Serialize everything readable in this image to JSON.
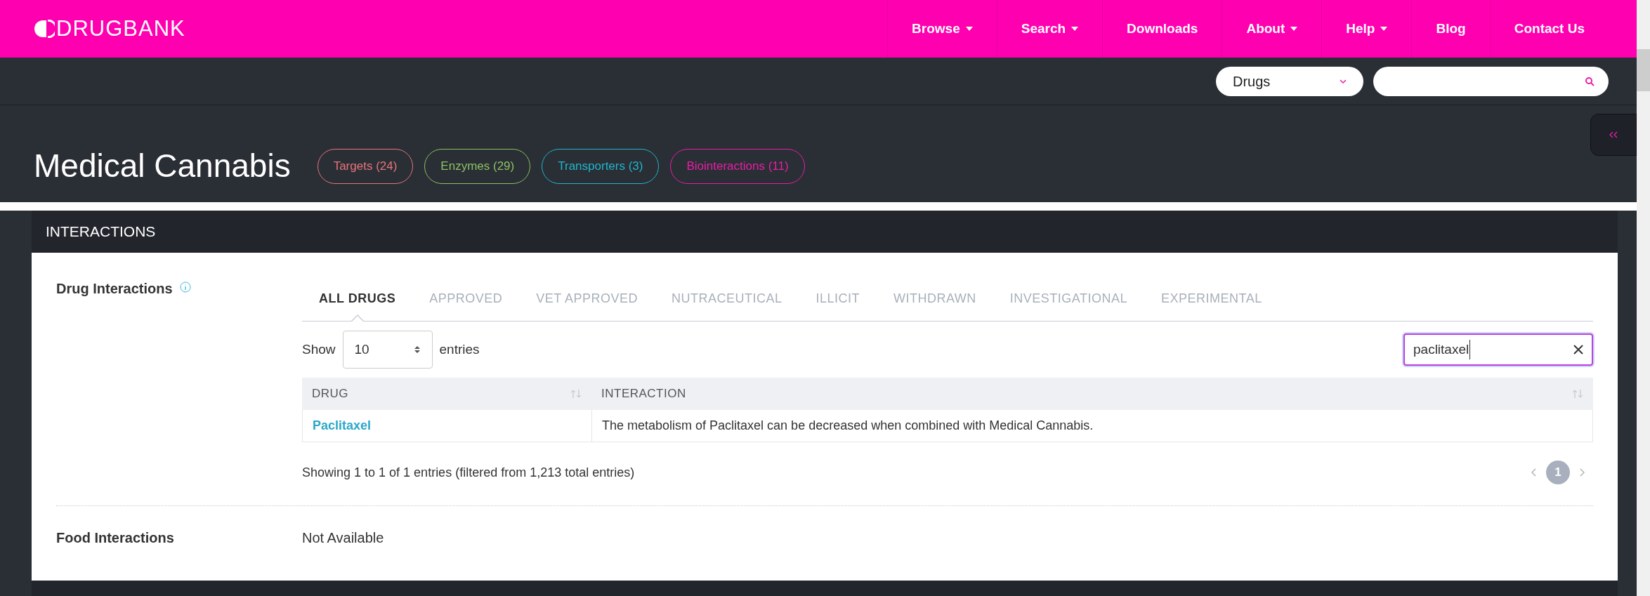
{
  "brand": {
    "name": "DRUGBANK"
  },
  "nav": [
    {
      "label": "Browse",
      "dropdown": true
    },
    {
      "label": "Search",
      "dropdown": true
    },
    {
      "label": "Downloads",
      "dropdown": false
    },
    {
      "label": "About",
      "dropdown": true
    },
    {
      "label": "Help",
      "dropdown": true
    },
    {
      "label": "Blog",
      "dropdown": false
    },
    {
      "label": "Contact Us",
      "dropdown": false
    }
  ],
  "site_search": {
    "category": "Drugs"
  },
  "title": "Medical Cannabis",
  "badges": [
    {
      "label": "Targets (24)",
      "color": "#e8757a"
    },
    {
      "label": "Enzymes (29)",
      "color": "#8cc063"
    },
    {
      "label": "Transporters (3)",
      "color": "#1fb7cc"
    },
    {
      "label": "Biointeractions (11)",
      "color": "#e81fa6"
    }
  ],
  "section": {
    "title": "INTERACTIONS",
    "drug_interactions": {
      "label": "Drug Interactions",
      "tabs": [
        {
          "label": "ALL DRUGS",
          "selected": true
        },
        {
          "label": "APPROVED",
          "selected": false
        },
        {
          "label": "VET APPROVED",
          "selected": false
        },
        {
          "label": "NUTRACEUTICAL",
          "selected": false
        },
        {
          "label": "ILLICIT",
          "selected": false
        },
        {
          "label": "WITHDRAWN",
          "selected": false
        },
        {
          "label": "INVESTIGATIONAL",
          "selected": false
        },
        {
          "label": "EXPERIMENTAL",
          "selected": false
        }
      ],
      "show_label": "Show",
      "page_size": "10",
      "entries_label": "entries",
      "filter": {
        "value": "paclitaxel"
      },
      "table": {
        "columns": [
          "DRUG",
          "INTERACTION"
        ],
        "rows": [
          {
            "drug": "Paclitaxel",
            "interaction": "The metabolism of Paclitaxel can be decreased when combined with Medical Cannabis."
          }
        ]
      },
      "info": "Showing 1 to 1 of 1 entries (filtered from 1,213 total entries)",
      "pages": [
        {
          "label": "1",
          "selected": true
        }
      ]
    },
    "food_interactions": {
      "label": "Food Interactions",
      "value": "Not Available"
    }
  }
}
